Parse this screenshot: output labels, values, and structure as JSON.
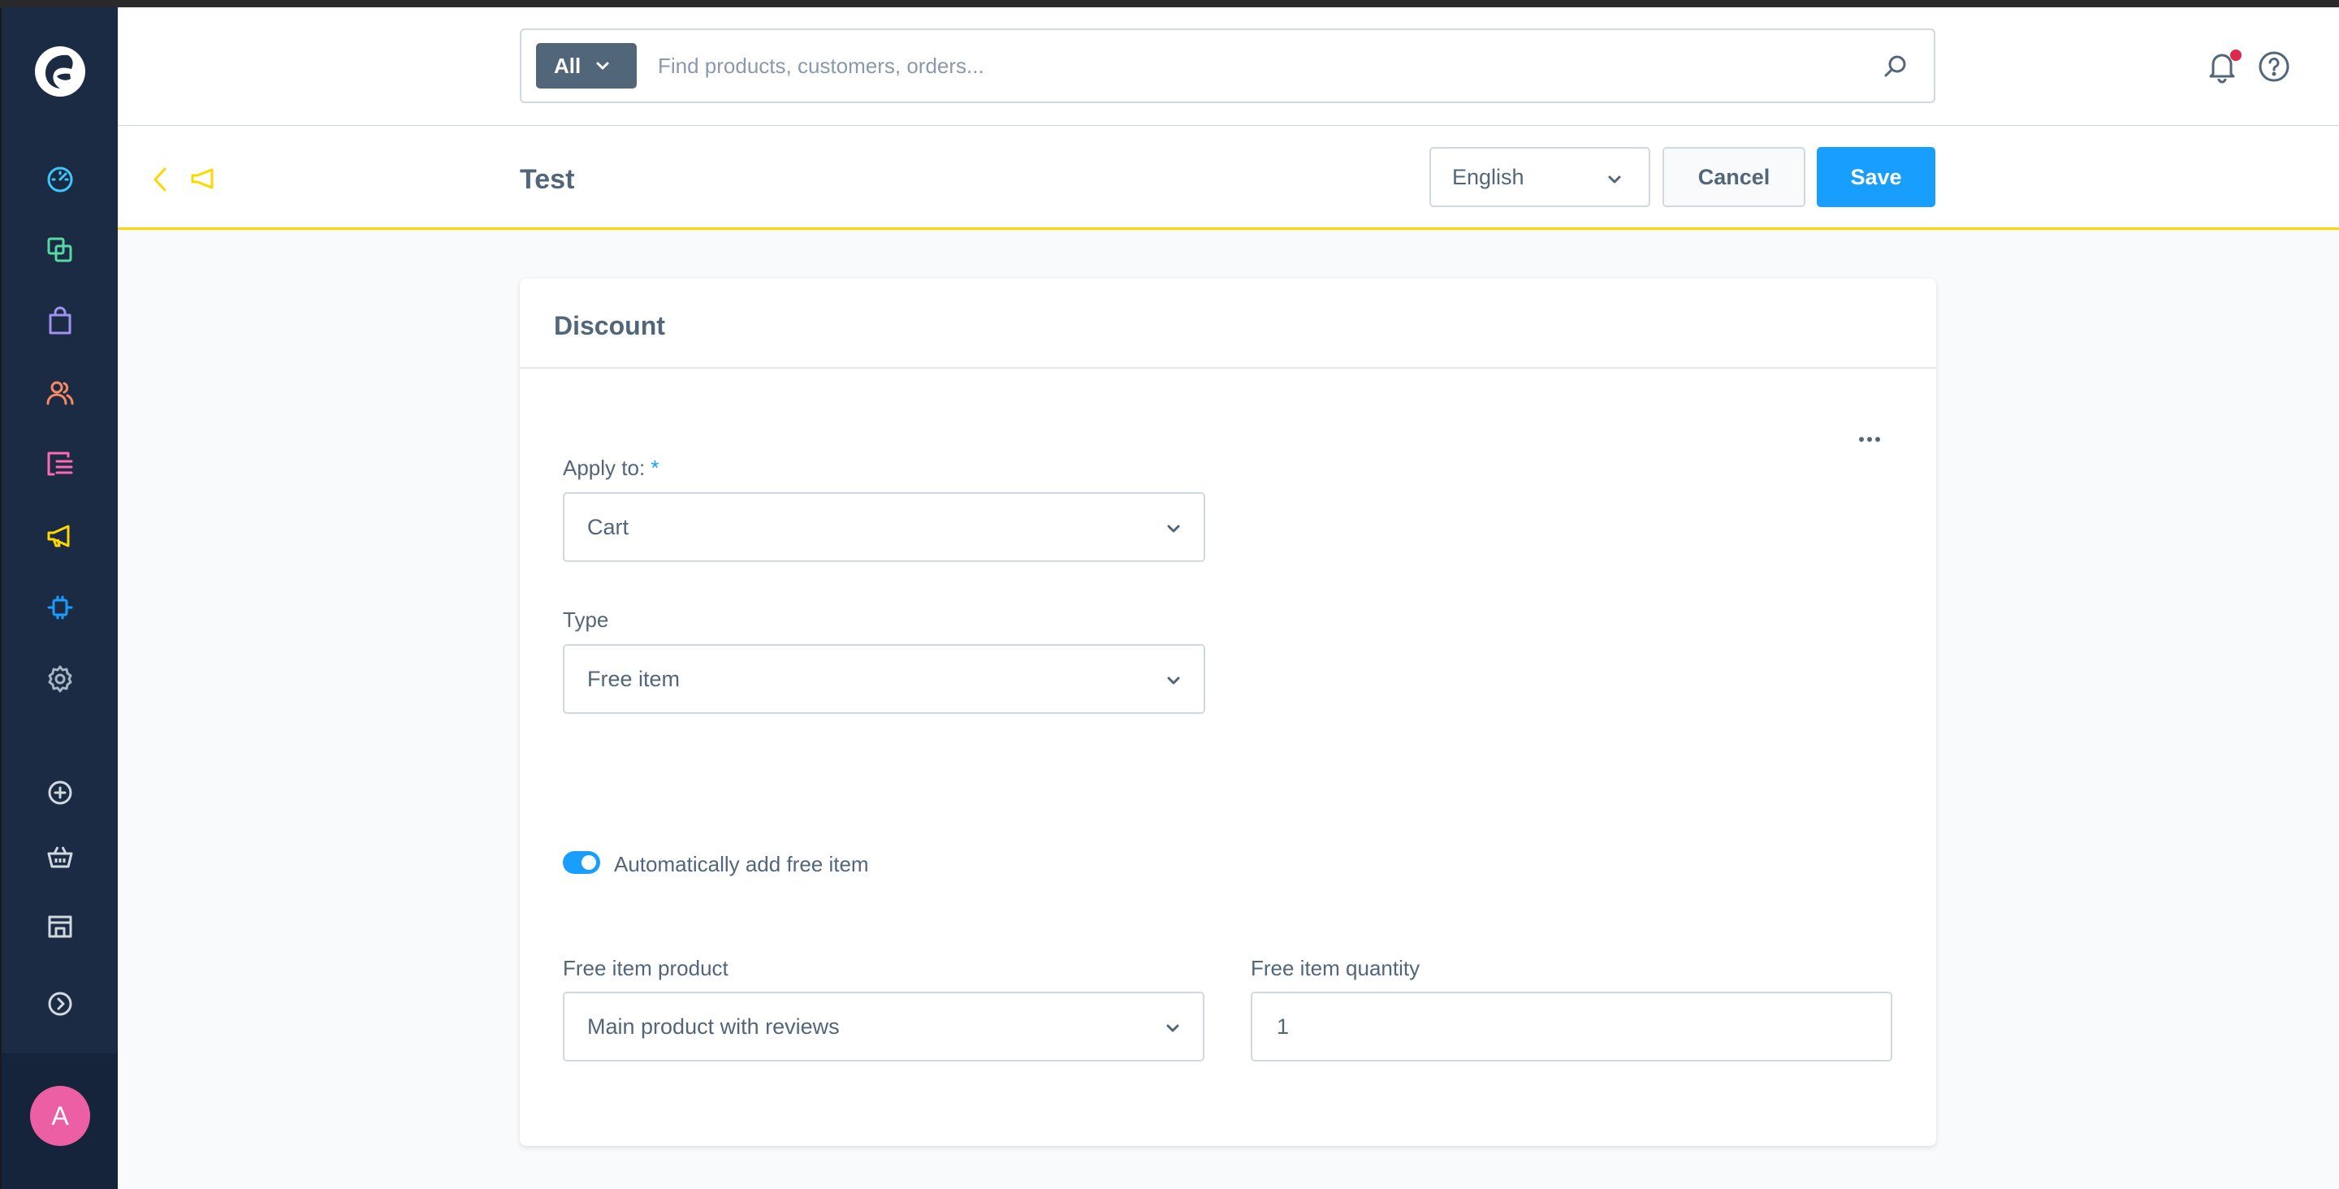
{
  "search": {
    "scope_label": "All",
    "placeholder": "Find products, customers, orders..."
  },
  "smartbar": {
    "title": "Test",
    "language": "English",
    "cancel_label": "Cancel",
    "save_label": "Save"
  },
  "discount": {
    "title": "Discount",
    "apply_to_label": "Apply to:",
    "apply_to_required": "*",
    "apply_to_value": "Cart",
    "type_label": "Type",
    "type_value": "Free item",
    "auto_add_label": "Automatically add free item",
    "auto_add_enabled": true,
    "free_item_product_label": "Free item product",
    "free_item_product_value": "Main product with reviews",
    "free_item_quantity_label": "Free item quantity",
    "free_item_quantity_value": "1"
  },
  "user": {
    "avatar_initial": "A"
  },
  "colors": {
    "sidebar": "#1b2b43",
    "primary": "#189eff",
    "marketing_accent": "#ffd700",
    "avatar": "#ec5fa5"
  },
  "sidebar_icons": [
    "dashboard-icon",
    "catalogues-icon",
    "orders-icon",
    "customers-icon",
    "content-icon",
    "marketing-icon",
    "extensions-icon",
    "settings-icon",
    "add-icon",
    "basket-icon",
    "sales-channel-icon",
    "expand-icon"
  ]
}
